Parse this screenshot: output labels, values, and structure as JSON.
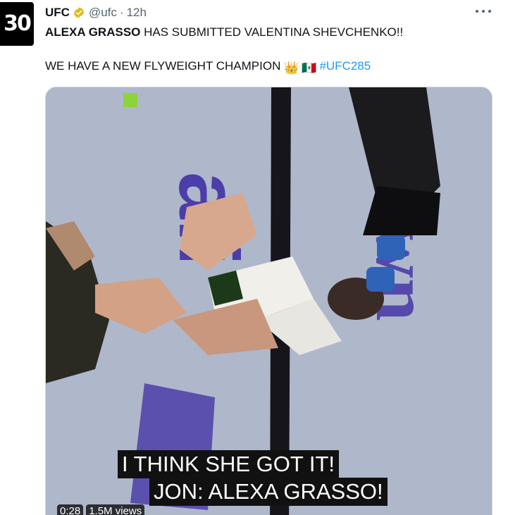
{
  "tweet": {
    "author": {
      "avatar_text": "30",
      "display_name": "UFC",
      "handle": "@ufc",
      "separator": "·",
      "timestamp": "12h",
      "verified_icon": "verified-badge-icon"
    },
    "text": {
      "line1_bold": "ALEXA GRASSO",
      "line1_rest": " HAS SUBMITTED VALENTINA SHEVCHENKO!!",
      "line2_text": "WE HAVE A NEW FLYWEIGHT CHAMPION ",
      "crown_emoji": "👑",
      "flag_emoji": "🇲🇽",
      "hashtag": "#UFC285"
    },
    "media": {
      "caption_line1": "I THINK SHE GOT IT!",
      "caption_line2": "JON: ALEXA GRASSO!",
      "duration": "0:28",
      "views": "1.5M views",
      "octagon_text": "ali",
      "octagon_brand": "Crown"
    }
  },
  "colors": {
    "accent": "#1d9bf0",
    "verified_gold": "#e2b719",
    "text_primary": "#0f1419",
    "text_secondary": "#536471"
  }
}
